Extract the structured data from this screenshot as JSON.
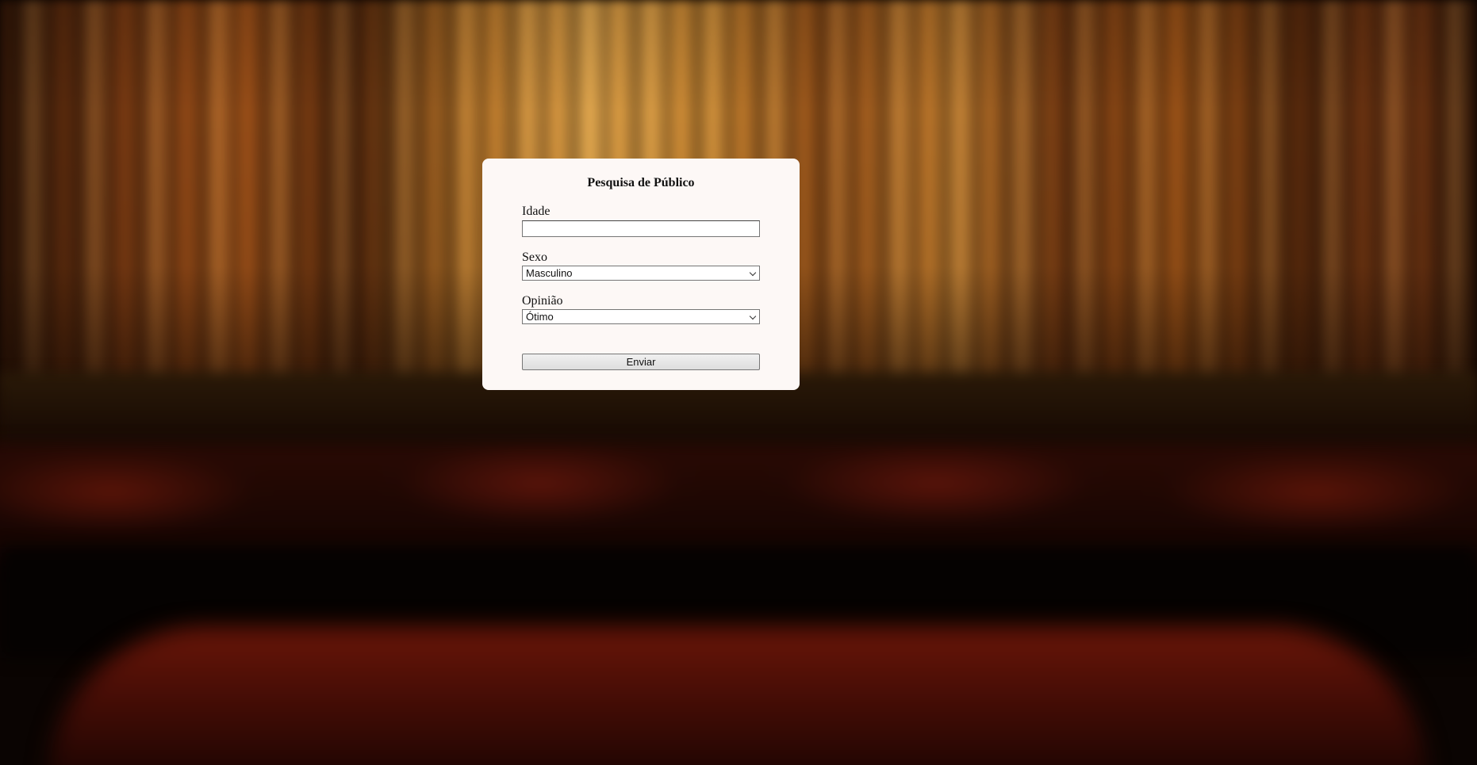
{
  "form": {
    "title": "Pesquisa de Público",
    "age": {
      "label": "Idade",
      "value": "",
      "placeholder": ""
    },
    "sex": {
      "label": "Sexo",
      "selected": "Masculino"
    },
    "opinion": {
      "label": "Opinião",
      "selected": "Ótimo"
    },
    "submit_label": "Enviar"
  }
}
